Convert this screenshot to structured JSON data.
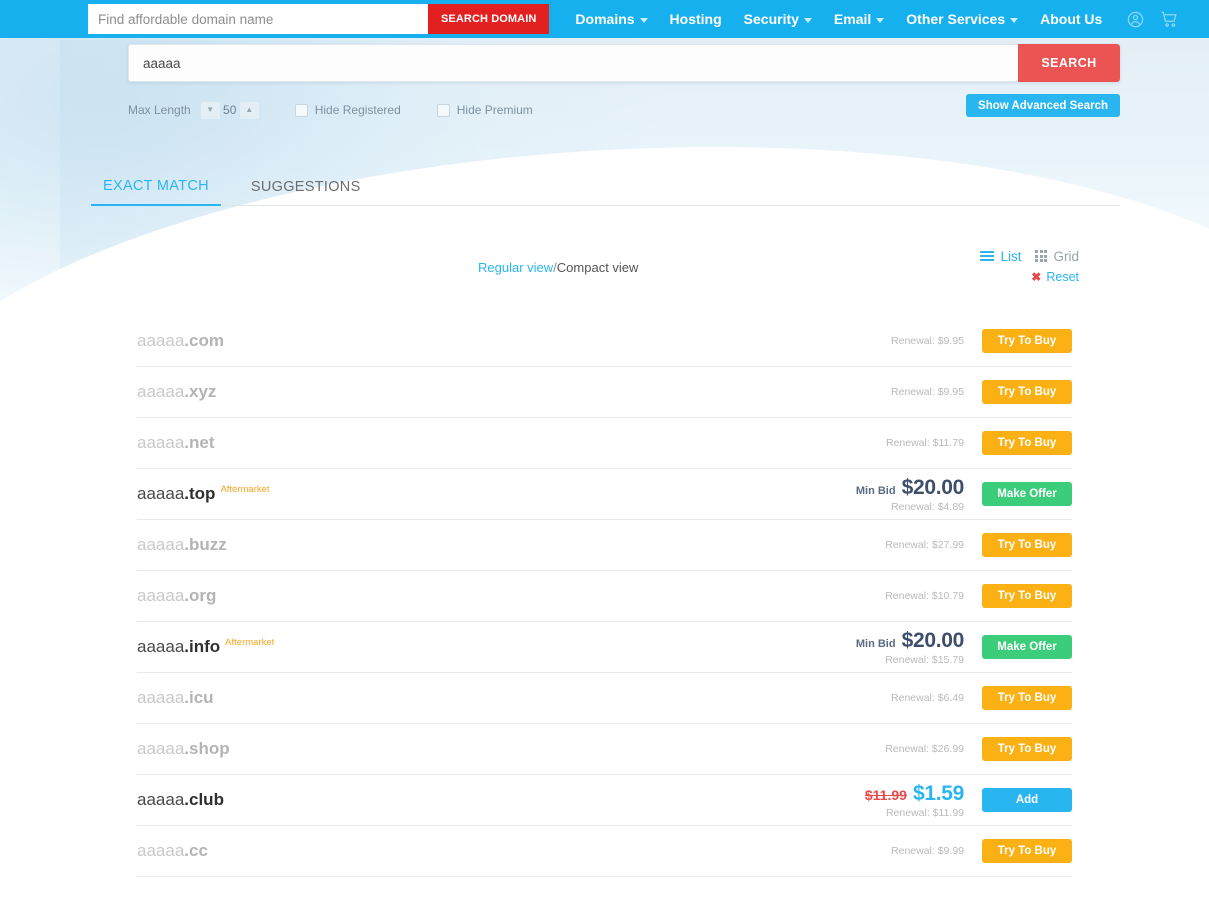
{
  "topnav": {
    "search_placeholder": "Find affordable domain name",
    "search_value": "",
    "search_button": "SEARCH DOMAIN",
    "links": [
      {
        "label": "Domains",
        "caret": true
      },
      {
        "label": "Hosting",
        "caret": false
      },
      {
        "label": "Security",
        "caret": true
      },
      {
        "label": "Email",
        "caret": true
      },
      {
        "label": "Other Services",
        "caret": true
      },
      {
        "label": "About Us",
        "caret": false
      }
    ],
    "icons": [
      {
        "name": "account-icon"
      },
      {
        "name": "cart-icon"
      }
    ]
  },
  "search_panel": {
    "query_value": "aaaaa",
    "search_button": "SEARCH",
    "max_length_label": "Max Length",
    "max_length_value": "50",
    "decrement_glyph": "▼",
    "increment_glyph": "▲",
    "hide_registered_label": "Hide Registered",
    "hide_premium_label": "Hide Premium",
    "advanced_button": "Show Advanced Search"
  },
  "tabs": [
    {
      "label": "EXACT MATCH",
      "active": true
    },
    {
      "label": "SUGGESTIONS",
      "active": false
    }
  ],
  "view_controls": {
    "regular_view": "Regular view",
    "separator": "/",
    "compact_view": "Compact view",
    "list_label": "List",
    "grid_label": "Grid",
    "reset_label": "Reset",
    "reset_glyph": "✖"
  },
  "colors": {
    "brand_blue": "#16b0ef",
    "accent_blue": "#29b6f0",
    "red": "#e32020",
    "search_red": "#ec5454",
    "orange": "#fbb014",
    "green": "#3ccd7b",
    "aftermarket_orange": "#f5a623",
    "muted_grey": "#b4b4b4"
  },
  "results": [
    {
      "sld": "aaaaa",
      "tld": ".com",
      "premium": false,
      "badge": "",
      "renewal": "Renewal: $9.95",
      "min_bid_label": "",
      "price": "",
      "old_price": "",
      "button": "Try To Buy",
      "button_style": "btn-try"
    },
    {
      "sld": "aaaaa",
      "tld": ".xyz",
      "premium": false,
      "badge": "",
      "renewal": "Renewal: $9.95",
      "min_bid_label": "",
      "price": "",
      "old_price": "",
      "button": "Try To Buy",
      "button_style": "btn-try"
    },
    {
      "sld": "aaaaa",
      "tld": ".net",
      "premium": false,
      "badge": "",
      "renewal": "Renewal: $11.79",
      "min_bid_label": "",
      "price": "",
      "old_price": "",
      "button": "Try To Buy",
      "button_style": "btn-try"
    },
    {
      "sld": "aaaaa",
      "tld": ".top",
      "premium": true,
      "badge": "Aftermarket",
      "renewal": "Renewal: $4.89",
      "min_bid_label": "Min Bid",
      "price": "$20.00",
      "old_price": "",
      "button": "Make Offer",
      "button_style": "btn-offer"
    },
    {
      "sld": "aaaaa",
      "tld": ".buzz",
      "premium": false,
      "badge": "",
      "renewal": "Renewal: $27.99",
      "min_bid_label": "",
      "price": "",
      "old_price": "",
      "button": "Try To Buy",
      "button_style": "btn-try"
    },
    {
      "sld": "aaaaa",
      "tld": ".org",
      "premium": false,
      "badge": "",
      "renewal": "Renewal: $10.79",
      "min_bid_label": "",
      "price": "",
      "old_price": "",
      "button": "Try To Buy",
      "button_style": "btn-try"
    },
    {
      "sld": "aaaaa",
      "tld": ".info",
      "premium": true,
      "badge": "Aftermarket",
      "renewal": "Renewal: $15.79",
      "min_bid_label": "Min Bid",
      "price": "$20.00",
      "old_price": "",
      "button": "Make Offer",
      "button_style": "btn-offer"
    },
    {
      "sld": "aaaaa",
      "tld": ".icu",
      "premium": false,
      "badge": "",
      "renewal": "Renewal: $6.49",
      "min_bid_label": "",
      "price": "",
      "old_price": "",
      "button": "Try To Buy",
      "button_style": "btn-try"
    },
    {
      "sld": "aaaaa",
      "tld": ".shop",
      "premium": false,
      "badge": "",
      "renewal": "Renewal: $26.99",
      "min_bid_label": "",
      "price": "",
      "old_price": "",
      "button": "Try To Buy",
      "button_style": "btn-try"
    },
    {
      "sld": "aaaaa",
      "tld": ".club",
      "premium": true,
      "badge": "",
      "renewal": "Renewal: $11.99",
      "min_bid_label": "",
      "price": "$1.59",
      "old_price": "$11.99",
      "button": "Add",
      "button_style": "btn-add"
    },
    {
      "sld": "aaaaa",
      "tld": ".cc",
      "premium": false,
      "badge": "",
      "renewal": "Renewal: $9.99",
      "min_bid_label": "",
      "price": "",
      "old_price": "",
      "button": "Try To Buy",
      "button_style": "btn-try"
    }
  ]
}
